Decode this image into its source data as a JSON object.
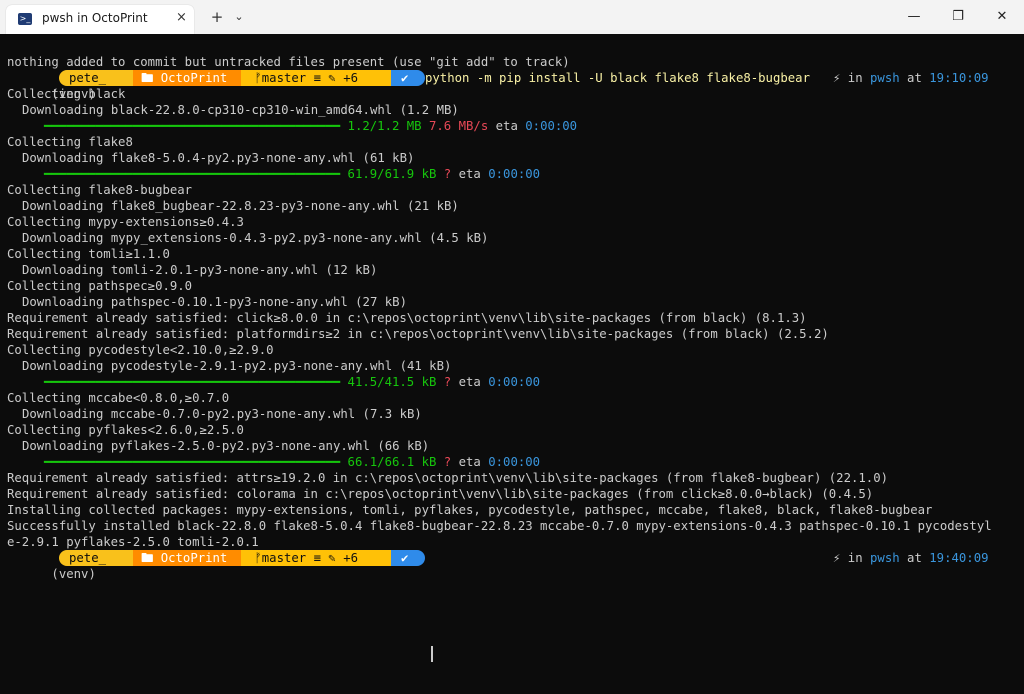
{
  "tab": {
    "title": "pwsh in OctoPrint",
    "close_label": "×"
  },
  "titlebar": {
    "new_tab_label": "+",
    "dropdown_label": "⌄",
    "minimize_label": "—",
    "maximize_label": "❐",
    "close_label": "✕"
  },
  "prompt": {
    "venv": "(venv)",
    "user": "pete_",
    "path": "🖿 OctoPrint",
    "git": " ᚠmaster ≡ ✎ +6",
    "ok": "✔",
    "right_prefix": "⚡ in ",
    "shell": "pwsh",
    "at": " at ",
    "time1": "19:10:09",
    "time2": "19:40:09"
  },
  "command": "python -m pip install -U black flake8 flake8-bugbear",
  "lines": {
    "l0": "nothing added to commit but untracked files present (use \"git add\" to track)",
    "l2": "Collecting black",
    "l3": "Downloading black-22.8.0-cp310-cp310-win_amd64.whl (1.2 MB)",
    "l4_bar": "━━━━━━━━━━━━━━━━━━━━━━━━━━━━━━━━━━━━━━━━ ",
    "l4_size": "1.2/1.2 MB",
    "l4_speed": " 7.6 MB/s",
    "l4_eta": " eta ",
    "l4_time": "0:00:00",
    "l6": "Collecting flake8",
    "l7": "Downloading flake8-5.0.4-py2.py3-none-any.whl (61 kB)",
    "l8_size": "61.9/61.9 kB",
    "l8_speed": " ?",
    "l10": "Collecting flake8-bugbear",
    "l11": "Downloading flake8_bugbear-22.8.23-py3-none-any.whl (21 kB)",
    "l12": "Collecting mypy-extensions≥0.4.3",
    "l13": "Downloading mypy_extensions-0.4.3-py2.py3-none-any.whl (4.5 kB)",
    "l14": "Collecting tomli≥1.1.0",
    "l15": "Downloading tomli-2.0.1-py3-none-any.whl (12 kB)",
    "l16": "Collecting pathspec≥0.9.0",
    "l17": "Downloading pathspec-0.10.1-py3-none-any.whl (27 kB)",
    "l18": "Requirement already satisfied: click≥8.0.0 in c:\\repos\\octoprint\\venv\\lib\\site-packages (from black) (8.1.3)",
    "l19": "Requirement already satisfied: platformdirs≥2 in c:\\repos\\octoprint\\venv\\lib\\site-packages (from black) (2.5.2)",
    "l20": "Collecting pycodestyle<2.10.0,≥2.9.0",
    "l21": "Downloading pycodestyle-2.9.1-py2.py3-none-any.whl (41 kB)",
    "l22_size": "41.5/41.5 kB",
    "l24": "Collecting mccabe<0.8.0,≥0.7.0",
    "l25": "Downloading mccabe-0.7.0-py2.py3-none-any.whl (7.3 kB)",
    "l26": "Collecting pyflakes<2.6.0,≥2.5.0",
    "l27": "Downloading pyflakes-2.5.0-py2.py3-none-any.whl (66 kB)",
    "l28_size": "66.1/66.1 kB",
    "l29": "Requirement already satisfied: attrs≥19.2.0 in c:\\repos\\octoprint\\venv\\lib\\site-packages (from flake8-bugbear) (22.1.0)",
    "l30": "Requirement already satisfied: colorama in c:\\repos\\octoprint\\venv\\lib\\site-packages (from click≥8.0.0→black) (0.4.5)",
    "l31": "Installing collected packages: mypy-extensions, tomli, pyflakes, pycodestyle, pathspec, mccabe, flake8, black, flake8-bugbear",
    "l32": "Successfully installed black-22.8.0 flake8-5.0.4 flake8-bugbear-22.8.23 mccabe-0.7.0 mypy-extensions-0.4.3 pathspec-0.10.1 pycodestyl",
    "l33": "e-2.9.1 pyflakes-2.5.0 tomli-2.0.1"
  },
  "colors": {
    "user_bg": "#f9c11b",
    "path_bg": "#ff8c00",
    "git_bg": "#ffc107",
    "ok_bg": "#2f8bea",
    "progress": "#16c60c",
    "speed": "#e74856",
    "time": "#3a96dd"
  }
}
